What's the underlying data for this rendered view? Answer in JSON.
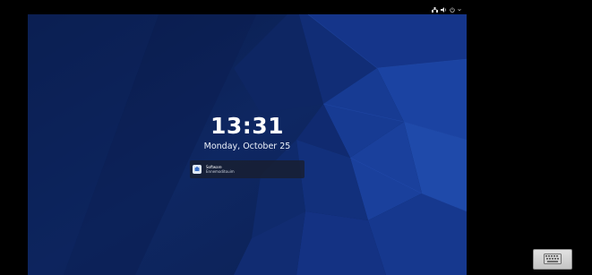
{
  "lock_screen": {
    "time": "13:31",
    "date": "Monday, October 25"
  },
  "top_bar": {
    "status_icons": [
      "network-icon",
      "volume-icon",
      "power-icon",
      "chevron-down-icon"
    ]
  },
  "notification": {
    "icon": "software-app-icon",
    "title": "Software",
    "body": "Ennemoditouim"
  },
  "host": {
    "keyboard_button_icon": "keyboard-icon"
  },
  "colors": {
    "wallpaper_base": "#0d2257",
    "wallpaper_accent": "#1f4aa8",
    "top_bar": "#000000",
    "host_background": "#000000"
  }
}
